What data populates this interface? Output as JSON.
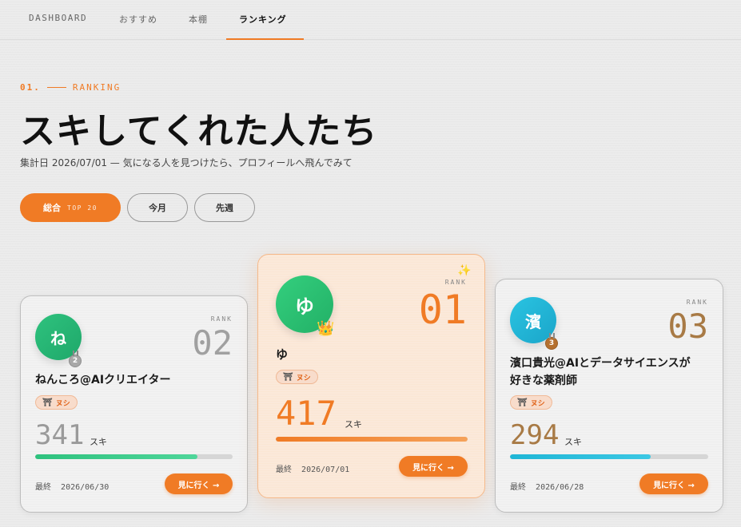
{
  "nav": {
    "items": [
      {
        "label": "DASHBOARD"
      },
      {
        "label": "おすすめ"
      },
      {
        "label": "本棚"
      },
      {
        "label": "ランキング"
      }
    ],
    "active": "ランキング"
  },
  "header": {
    "eyebrow_num": "01.",
    "eyebrow_label": "RANKING",
    "title": "スキしてくれた人たち",
    "subtitle": "集計日 2026/07/01 — 気になる人を見つけたら、プロフィールへ飛んでみて"
  },
  "filters": [
    {
      "label": "総合",
      "tag": "TOP 20",
      "active": true
    },
    {
      "label": "今月",
      "active": false
    },
    {
      "label": "先週",
      "active": false
    }
  ],
  "cards": [
    {
      "rank_label": "RANK",
      "rank": "02",
      "avatar_char": "ね",
      "name": "ねんころ@AIクリエイター",
      "badge": "ヌシ",
      "count": "341",
      "count_unit": "スキ",
      "progress": 0.82,
      "last_label": "最終",
      "last_date": "2026/06/30",
      "button": "見に行く →",
      "medal": "2"
    },
    {
      "rank_label": "RANK",
      "rank": "01",
      "avatar_char": "ゆ",
      "name": "ゆ",
      "badge": "ヌシ",
      "count": "417",
      "count_unit": "スキ",
      "progress": 1.0,
      "last_label": "最終",
      "last_date": "2026/07/01",
      "button": "見に行く →"
    },
    {
      "rank_label": "RANK",
      "rank": "03",
      "avatar_char": "濱",
      "name_line1": "濱口貴光@AIとデータサイエンスが",
      "name_line2": "好きな薬剤師",
      "badge": "ヌシ",
      "count": "294",
      "count_unit": "スキ",
      "progress": 0.71,
      "last_label": "最終",
      "last_date": "2026/06/28",
      "button": "見に行く →",
      "medal": "3"
    }
  ],
  "colors": {
    "accent": "#f07b25",
    "green": "#2ec27e",
    "cyan": "#1fb6d6",
    "bronze": "#a87a45",
    "silver": "#9a9a9a"
  }
}
